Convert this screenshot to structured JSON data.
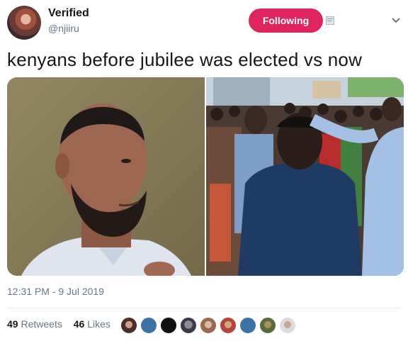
{
  "author": {
    "display_name": "Verified",
    "handle": "@njiiru"
  },
  "actions": {
    "follow_label": "Following"
  },
  "tweet": {
    "text": "kenyans before jubilee was elected vs now",
    "timestamp": "12:31 PM - 9 Jul 2019"
  },
  "engagement": {
    "retweets_count": "49",
    "retweets_label": "Retweets",
    "likes_count": "46",
    "likes_label": "Likes"
  },
  "colors": {
    "follow_button": "#e0245e",
    "secondary_text": "#657786",
    "liker_blue": "#3b73a6",
    "liker_black": "#111111"
  },
  "icons": [
    "small-square-icon",
    "chevron-down-icon"
  ]
}
